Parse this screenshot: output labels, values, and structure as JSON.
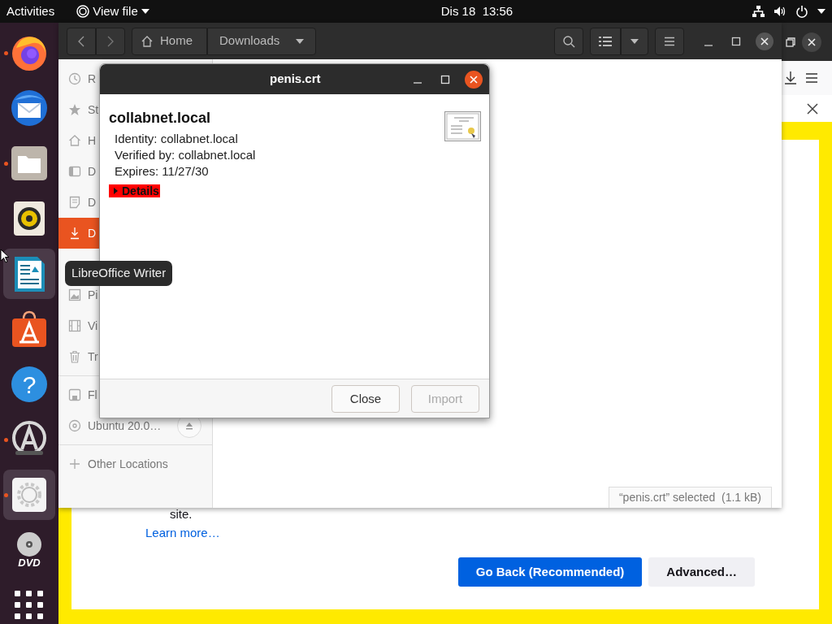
{
  "top_bar": {
    "activities": "Activities",
    "app_menu": "View file",
    "clock": "Dis 18  13:56"
  },
  "dock": [
    {
      "kind": "firefox",
      "running": true,
      "highlighted": false
    },
    {
      "kind": "thunderbird",
      "running": false,
      "highlighted": false
    },
    {
      "kind": "files",
      "running": true,
      "highlighted": false
    },
    {
      "kind": "rhythmbox",
      "running": false,
      "highlighted": false
    },
    {
      "kind": "writer",
      "running": false,
      "highlighted": true
    },
    {
      "kind": "software",
      "running": false,
      "highlighted": false
    },
    {
      "kind": "help",
      "running": false,
      "highlighted": false,
      "glyph": "?"
    },
    {
      "kind": "installer",
      "running": true,
      "highlighted": false
    },
    {
      "kind": "settings",
      "running": true,
      "highlighted": true
    },
    {
      "kind": "dvd",
      "running": false,
      "highlighted": false,
      "glyph": "DVD"
    },
    {
      "kind": "apps",
      "running": false,
      "highlighted": false
    }
  ],
  "tooltip": "LibreOffice Writer",
  "browser": {
    "text_tail": "site.",
    "link": "Learn more…",
    "buttons": [
      {
        "label": "Go Back (Recommended)",
        "kind": "primary"
      },
      {
        "label": "Advanced…",
        "kind": "secondary"
      }
    ]
  },
  "file_manager": {
    "path": [
      {
        "label": "Home",
        "kind": "home"
      },
      {
        "label": "Downloads",
        "kind": "dropdown"
      }
    ],
    "places": [
      {
        "label": "R",
        "kind": "clock",
        "selected": false
      },
      {
        "label": "St",
        "kind": "star",
        "selected": false
      },
      {
        "label": "H",
        "kind": "home",
        "selected": false
      },
      {
        "label": "D",
        "kind": "desktop",
        "selected": false
      },
      {
        "label": "D",
        "kind": "document",
        "selected": false
      },
      {
        "label": "D",
        "kind": "download",
        "selected": true
      },
      {
        "label": "Pi",
        "kind": "picture",
        "selected": false
      },
      {
        "label": "Vi",
        "kind": "film",
        "selected": false
      },
      {
        "label": "Tr",
        "kind": "trash",
        "selected": false
      }
    ],
    "devices": [
      {
        "label": "Fl",
        "kind": "floppy"
      },
      {
        "label": "Ubuntu 20.0…",
        "kind": "disc"
      }
    ],
    "other": "Other Locations",
    "status": "“penis.crt” selected  (1.1 kB)"
  },
  "dialog": {
    "title": "penis.crt",
    "subject": "collabnet.local",
    "fields": [
      "Identity: collabnet.local",
      "Verified by: collabnet.local",
      "Expires: 11/27/30"
    ],
    "details": {
      "label": "Details",
      "expanded": false
    },
    "buttons": [
      {
        "label": "Close",
        "disabled": false
      },
      {
        "label": "Import",
        "disabled": true
      }
    ]
  }
}
